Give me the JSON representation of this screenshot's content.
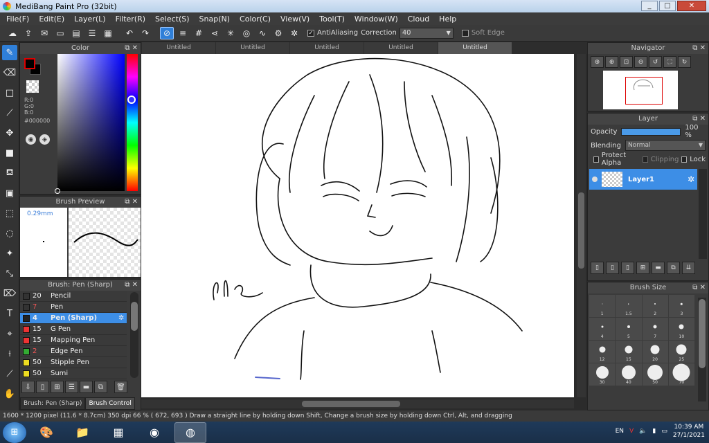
{
  "window": {
    "title": "MediBang Paint Pro (32bit)",
    "min": "_",
    "max": "□",
    "close": "✕"
  },
  "menu": [
    "File(F)",
    "Edit(E)",
    "Layer(L)",
    "Filter(R)",
    "Select(S)",
    "Snap(N)",
    "Color(C)",
    "View(V)",
    "Tool(T)",
    "Window(W)",
    "Cloud",
    "Help"
  ],
  "toolbar": {
    "antialiasing_label": "AntiAliasing",
    "correction_label": "Correction",
    "correction_value": "40",
    "soft_edge_label": "Soft Edge"
  },
  "color_panel": {
    "title": "Color",
    "fg_color": "#000000",
    "r": "R:0",
    "g": "G:0",
    "b": "B:0",
    "hex": "#000000"
  },
  "brush_preview": {
    "title": "Brush Preview",
    "size": "0.29mm"
  },
  "brush_list": {
    "title": "Brush: Pen (Sharp)",
    "items": [
      {
        "size": "20",
        "name": "Pencil",
        "color": "#333333"
      },
      {
        "size": "7",
        "name": "Pen",
        "color": "#333333"
      },
      {
        "size": "4",
        "name": "Pen (Sharp)",
        "color": "#222222"
      },
      {
        "size": "15",
        "name": "G Pen",
        "color": "#ee3333"
      },
      {
        "size": "15",
        "name": "Mapping Pen",
        "color": "#ee3333"
      },
      {
        "size": "2",
        "name": "Edge Pen",
        "color": "#33aa33"
      },
      {
        "size": "50",
        "name": "Stipple Pen",
        "color": "#eedd22"
      },
      {
        "size": "50",
        "name": "Sumi",
        "color": "#eedd22"
      }
    ],
    "tabs": [
      "Brush: Pen (Sharp)",
      "Brush Control"
    ]
  },
  "doc_tabs": [
    "Untitled",
    "Untitled",
    "Untitled",
    "Untitled",
    "Untitled"
  ],
  "navigator": {
    "title": "Navigator"
  },
  "layer_panel": {
    "title": "Layer",
    "opacity_label": "Opacity",
    "opacity_value": "100 %",
    "opacity_fraction": 1.0,
    "blending_label": "Blending",
    "blending_value": "Normal",
    "protect_alpha": "Protect Alpha",
    "clipping": "Clipping",
    "lock": "Lock",
    "layer_name": "Layer1"
  },
  "brush_size": {
    "title": "Brush Size",
    "sizes": [
      "1",
      "1.5",
      "2",
      "3",
      "4",
      "5",
      "7",
      "10",
      "12",
      "15",
      "20",
      "25",
      "30",
      "40",
      "50",
      "70"
    ]
  },
  "status": {
    "text": "1600 * 1200 pixel   (11.6 * 8.7cm)   350 dpi   66 %   ( 672, 693 )   Draw a straight line by holding down Shift, Change a brush size by holding down Ctrl, Alt, and dragging"
  },
  "taskbar": {
    "lang": "EN",
    "time": "10:39 AM",
    "date": "27/1/2021"
  }
}
